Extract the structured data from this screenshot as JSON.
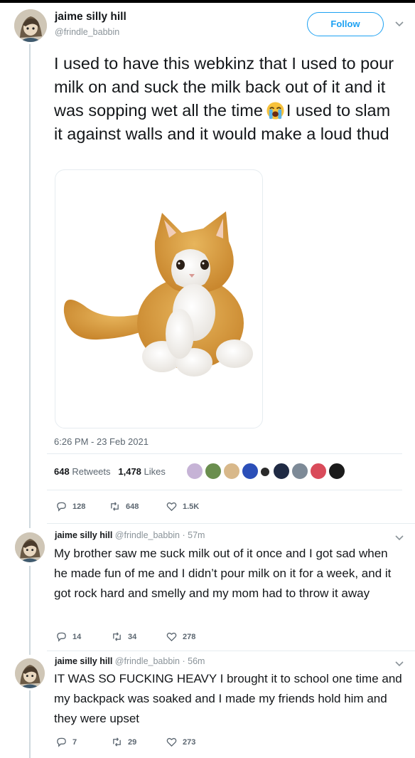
{
  "main_tweet": {
    "display_name": "jaime silly hill",
    "handle": "@frindle_babbin",
    "follow_label": "Follow",
    "text_before_emoji": "I used to have this webkinz that I used to pour milk on and suck the milk back out of it and it was sopping wet all the time",
    "emoji_icon": "loudly-crying-face-icon",
    "text_after_emoji": "I used to slam it against walls and it would make a loud thud",
    "image_icon": "plush-cat-toy-image",
    "timestamp": "6:26 PM - 23 Feb 2021",
    "retweets_count": "648",
    "retweets_label": "Retweets",
    "likes_count": "1,478",
    "likes_label": "Likes",
    "replies": "128",
    "retweets": "648",
    "likes": "1.5K"
  },
  "replies": [
    {
      "display_name": "jaime silly hill",
      "handle": "@frindle_babbin",
      "time": "· 57m",
      "text": "My brother saw me suck milk out of it once and I got sad when he made fun of me and I didn’t pour milk on it for a week, and it got rock hard and smelly and my mom had to throw it away",
      "replies": "14",
      "retweets": "34",
      "likes": "278"
    },
    {
      "display_name": "jaime silly hill",
      "handle": "@frindle_babbin",
      "time": "· 56m",
      "text": "IT WAS SO FUCKING HEAVY I brought it to school one time and my backpack was soaked and I made my friends hold him and they were upset",
      "replies": "7",
      "retweets": "29",
      "likes": "273"
    }
  ],
  "colors": {
    "accent": "#1da1f2",
    "secondary_text": "#5b6670",
    "thread_line": "#cfd9de"
  }
}
